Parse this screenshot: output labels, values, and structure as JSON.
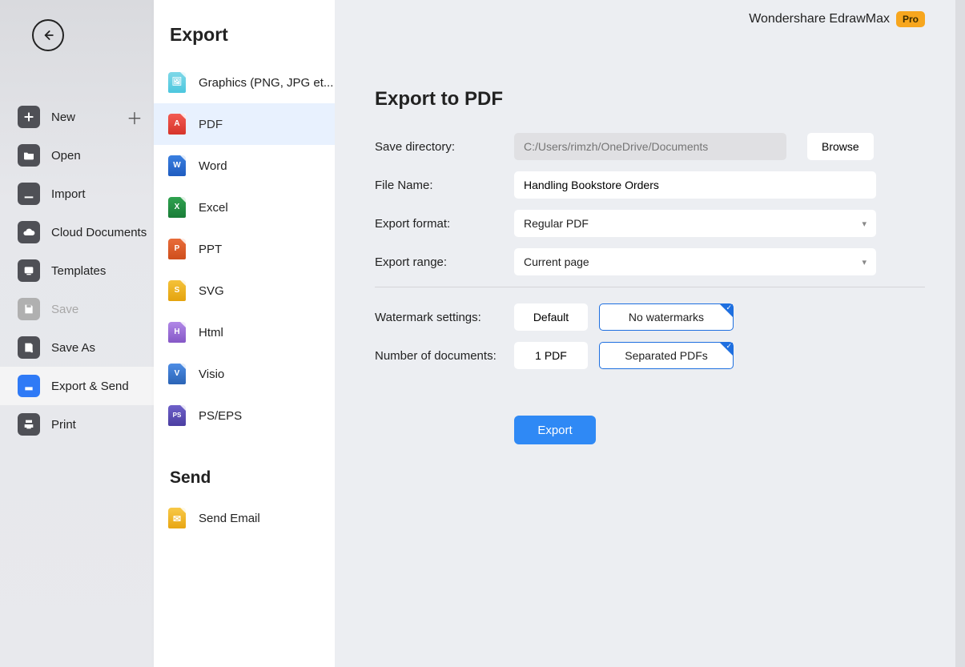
{
  "brand": {
    "name": "Wondershare EdrawMax",
    "badge": "Pro"
  },
  "sidebar": {
    "items": [
      {
        "label": "New"
      },
      {
        "label": "Open"
      },
      {
        "label": "Import"
      },
      {
        "label": "Cloud Documents"
      },
      {
        "label": "Templates"
      },
      {
        "label": "Save"
      },
      {
        "label": "Save As"
      },
      {
        "label": "Export & Send"
      },
      {
        "label": "Print"
      }
    ]
  },
  "exportPanel": {
    "title": "Export",
    "items": [
      {
        "label": "Graphics (PNG, JPG et..."
      },
      {
        "label": "PDF"
      },
      {
        "label": "Word"
      },
      {
        "label": "Excel"
      },
      {
        "label": "PPT"
      },
      {
        "label": "SVG"
      },
      {
        "label": "Html"
      },
      {
        "label": "Visio"
      },
      {
        "label": "PS/EPS"
      }
    ],
    "sendTitle": "Send",
    "sendItems": [
      {
        "label": "Send Email"
      }
    ]
  },
  "form": {
    "title": "Export to PDF",
    "labels": {
      "saveDirectory": "Save directory:",
      "fileName": "File Name:",
      "exportFormat": "Export format:",
      "exportRange": "Export range:",
      "watermark": "Watermark settings:",
      "numDocs": "Number of documents:"
    },
    "values": {
      "saveDirectoryPlaceholder": "C:/Users/rimzh/OneDrive/Documents",
      "fileName": "Handling Bookstore Orders",
      "exportFormat": "Regular PDF",
      "exportRange": "Current page"
    },
    "buttons": {
      "browse": "Browse",
      "watermarkDefault": "Default",
      "watermarkNone": "No watermarks",
      "docsSingle": "1 PDF",
      "docsSeparated": "Separated PDFs",
      "export": "Export"
    }
  }
}
